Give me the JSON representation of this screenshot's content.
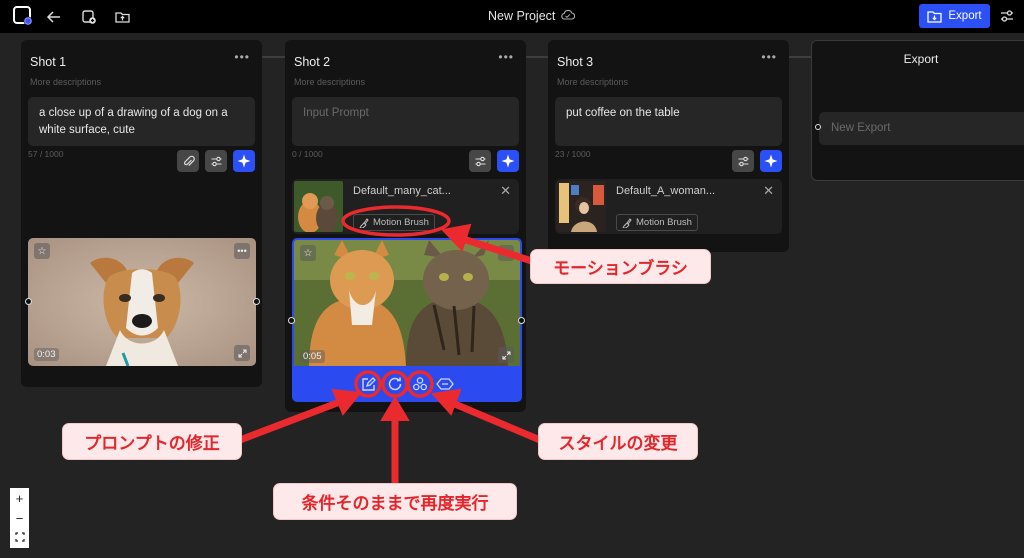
{
  "topbar": {
    "title": "New Project",
    "export_label": "Export",
    "icons": [
      "app-logo-icon",
      "back-arrow-icon",
      "new-shot-icon",
      "upload-folder-icon",
      "cloud-sync-icon",
      "sliders-icon"
    ]
  },
  "shots": [
    {
      "title": "Shot 1",
      "description": "More descriptions",
      "prompt": "a close up of a drawing of a dog on a white surface, cute",
      "char_count": "57 / 1000",
      "video_duration": "0:03",
      "has_attachment_button": true
    },
    {
      "title": "Shot 2",
      "description": "More descriptions",
      "prompt": "",
      "prompt_placeholder": "Input Prompt",
      "char_count": "0 / 1000",
      "reference": {
        "name": "Default_many_cat...",
        "motion_brush_label": "Motion Brush"
      },
      "video_duration": "0:05"
    },
    {
      "title": "Shot 3",
      "description": "More descriptions",
      "prompt": "put coffee on the table",
      "char_count": "23 / 1000",
      "reference": {
        "name": "Default_A_woman...",
        "motion_brush_label": "Motion Brush"
      }
    }
  ],
  "export_panel": {
    "title": "Export",
    "new_export_placeholder": "New Export"
  },
  "action_bar": {
    "icons": [
      "edit-prompt-icon",
      "regenerate-icon",
      "style-change-icon",
      "extend-icon"
    ]
  },
  "annotations": {
    "motion_brush": "モーションブラシ",
    "edit_prompt": "プロンプトの修正",
    "regenerate": "条件そのままで再度実行",
    "change_style": "スタイルの変更"
  },
  "zoom_controls": {
    "zoom_in": "+",
    "zoom_out": "−",
    "fit": "⛶"
  },
  "colors": {
    "accent": "#2b50f5",
    "annotation_red": "#e5252c",
    "annotation_bg": "#fde9e9",
    "card_bg": "#131313",
    "canvas_bg": "#232323"
  }
}
